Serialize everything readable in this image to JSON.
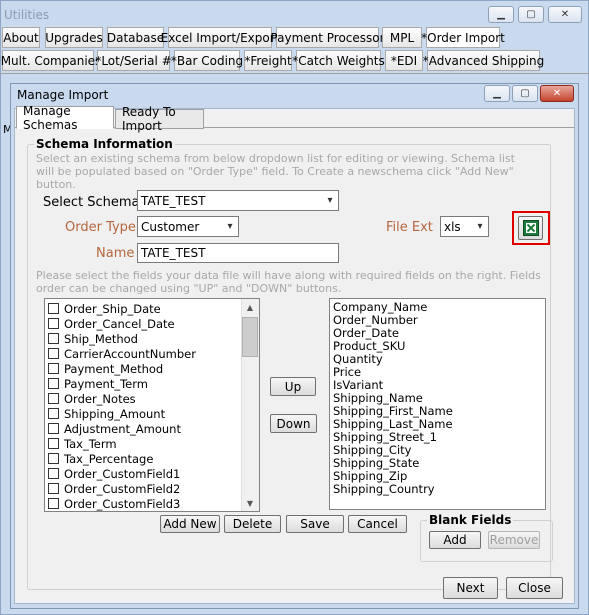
{
  "outer_window": {
    "title": "Utilities",
    "tabs_row1": [
      "About",
      "Upgrades",
      "Database",
      "Excel Import/Export",
      "Payment Processor",
      "MPL",
      "*Order Import"
    ],
    "tabs_row2": [
      "*Mult. Companies",
      "*Lot/Serial #",
      "*Bar Coding",
      "*Freight",
      "*Catch Weights",
      "*EDI",
      "*Advanced Shipping"
    ],
    "side_letter": "M"
  },
  "dialog": {
    "title": "Manage Import",
    "tabs": [
      "Manage Schemas",
      "Ready To Import"
    ],
    "schema_info": {
      "heading": "Schema Information",
      "hint": "Select an existing schema from below dropdown list for editing or viewing. Schema list will be populated based on \"Order Type\" field. To Create a newschema click \"Add New\" button.",
      "select_schema_label": "Select Schema",
      "select_schema_value": "TATE_TEST",
      "order_type_label": "Order Type",
      "order_type_value": "Customer",
      "name_label": "Name",
      "name_value": "TATE_TEST",
      "file_ext_label": "File Ext",
      "file_ext_value": "xls",
      "excel_icon": "excel-icon"
    },
    "fields_hint": "Please select the fields your data file will have along with required fields on the right. Fields order can be changed using \"UP\" and \"DOWN\" buttons.",
    "available_fields": [
      "Order_Ship_Date",
      "Order_Cancel_Date",
      "Ship_Method",
      "CarrierAccountNumber",
      "Payment_Method",
      "Payment_Term",
      "Order_Notes",
      "Shipping_Amount",
      "Adjustment_Amount",
      "Tax_Term",
      "Tax_Percentage",
      "Order_CustomField1",
      "Order_CustomField2",
      "Order_CustomField3"
    ],
    "required_fields": [
      "Company_Name",
      "Order_Number",
      "Order_Date",
      "Product_SKU",
      "Quantity",
      "Price",
      "IsVariant",
      "Shipping_Name",
      "Shipping_First_Name",
      "Shipping_Last_Name",
      "Shipping_Street_1",
      "Shipping_City",
      "Shipping_State",
      "Shipping_Zip",
      "Shipping_Country"
    ],
    "up_label": "Up",
    "down_label": "Down",
    "add_new_label": "Add New",
    "delete_label": "Delete",
    "save_label": "Save",
    "cancel_label": "Cancel",
    "blank_fields": {
      "heading": "Blank Fields",
      "add_label": "Add",
      "remove_label": "Remove"
    },
    "next_label": "Next",
    "close_label": "Close",
    "highlight_color": "#e00000"
  }
}
